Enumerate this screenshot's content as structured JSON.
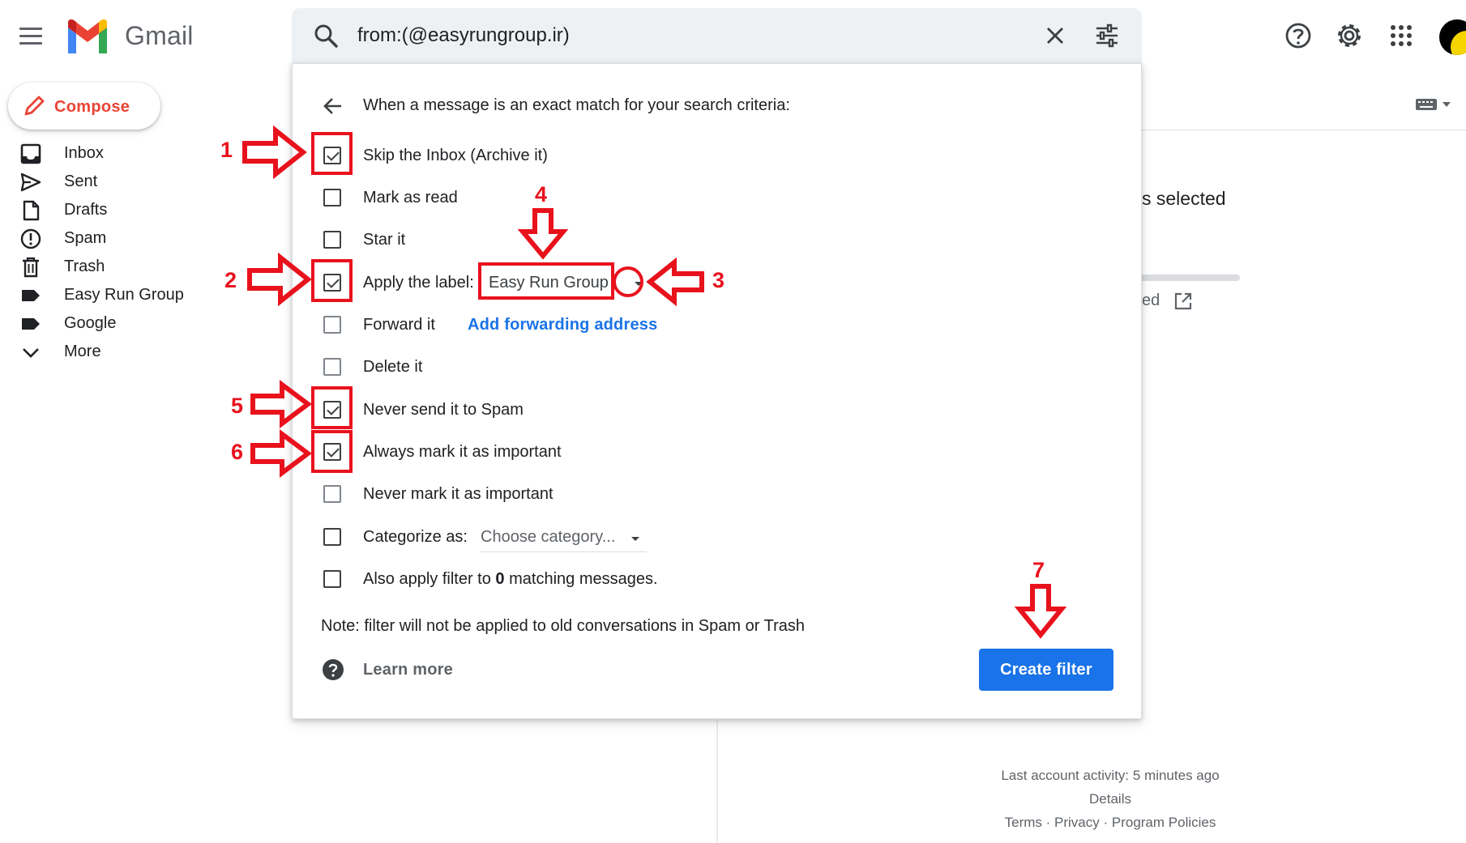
{
  "app": {
    "title": "Gmail"
  },
  "search": {
    "query": "from:(@easyrungroup.ir)"
  },
  "sidebar": {
    "compose_label": "Compose",
    "items": [
      {
        "label": "Inbox",
        "icon": "inbox-icon"
      },
      {
        "label": "Sent",
        "icon": "send-icon"
      },
      {
        "label": "Drafts",
        "icon": "draft-icon"
      },
      {
        "label": "Spam",
        "icon": "spam-icon"
      },
      {
        "label": "Trash",
        "icon": "trash-icon"
      },
      {
        "label": "Easy Run Group",
        "icon": "label-icon"
      },
      {
        "label": "Google",
        "icon": "label-icon"
      },
      {
        "label": "More",
        "icon": "chevron-down-icon"
      }
    ]
  },
  "background": {
    "selected_fragment": "s selected",
    "managed_fragment": "ed",
    "footer": {
      "last_activity": "Last account activity: 5 minutes ago",
      "details": "Details",
      "links": "Terms · Privacy · Program Policies"
    }
  },
  "filter_dialog": {
    "heading": "When a message is an exact match for your search criteria:",
    "options": {
      "skip_inbox": {
        "label": "Skip the Inbox (Archive it)",
        "checked": true
      },
      "mark_read": {
        "label": "Mark as read",
        "checked": false
      },
      "star": {
        "label": "Star it",
        "checked": false
      },
      "apply_label": {
        "label": "Apply the label:",
        "checked": true,
        "value": "Easy Run Group"
      },
      "forward": {
        "label": "Forward it",
        "checked": false,
        "link": "Add forwarding address"
      },
      "delete": {
        "label": "Delete it",
        "checked": false
      },
      "never_spam": {
        "label": "Never send it to Spam",
        "checked": true
      },
      "always_important": {
        "label": "Always mark it as important",
        "checked": true
      },
      "never_important": {
        "label": "Never mark it as important",
        "checked": false
      },
      "categorize": {
        "label": "Categorize as:",
        "checked": false,
        "value": "Choose category..."
      },
      "also_apply": {
        "label_before": "Also apply filter to ",
        "count": "0",
        "label_after": " matching messages.",
        "checked": false
      }
    },
    "note": "Note: filter will not be applied to old conversations in Spam or Trash",
    "learn_more": "Learn more",
    "create_button": "Create filter"
  },
  "annotations": {
    "numbers": [
      "1",
      "2",
      "3",
      "4",
      "5",
      "6",
      "7"
    ],
    "color": "#e8121d"
  },
  "colors": {
    "accent": "#1a73e8",
    "compose_text": "#ea4335",
    "annotation": "#e8121d"
  }
}
